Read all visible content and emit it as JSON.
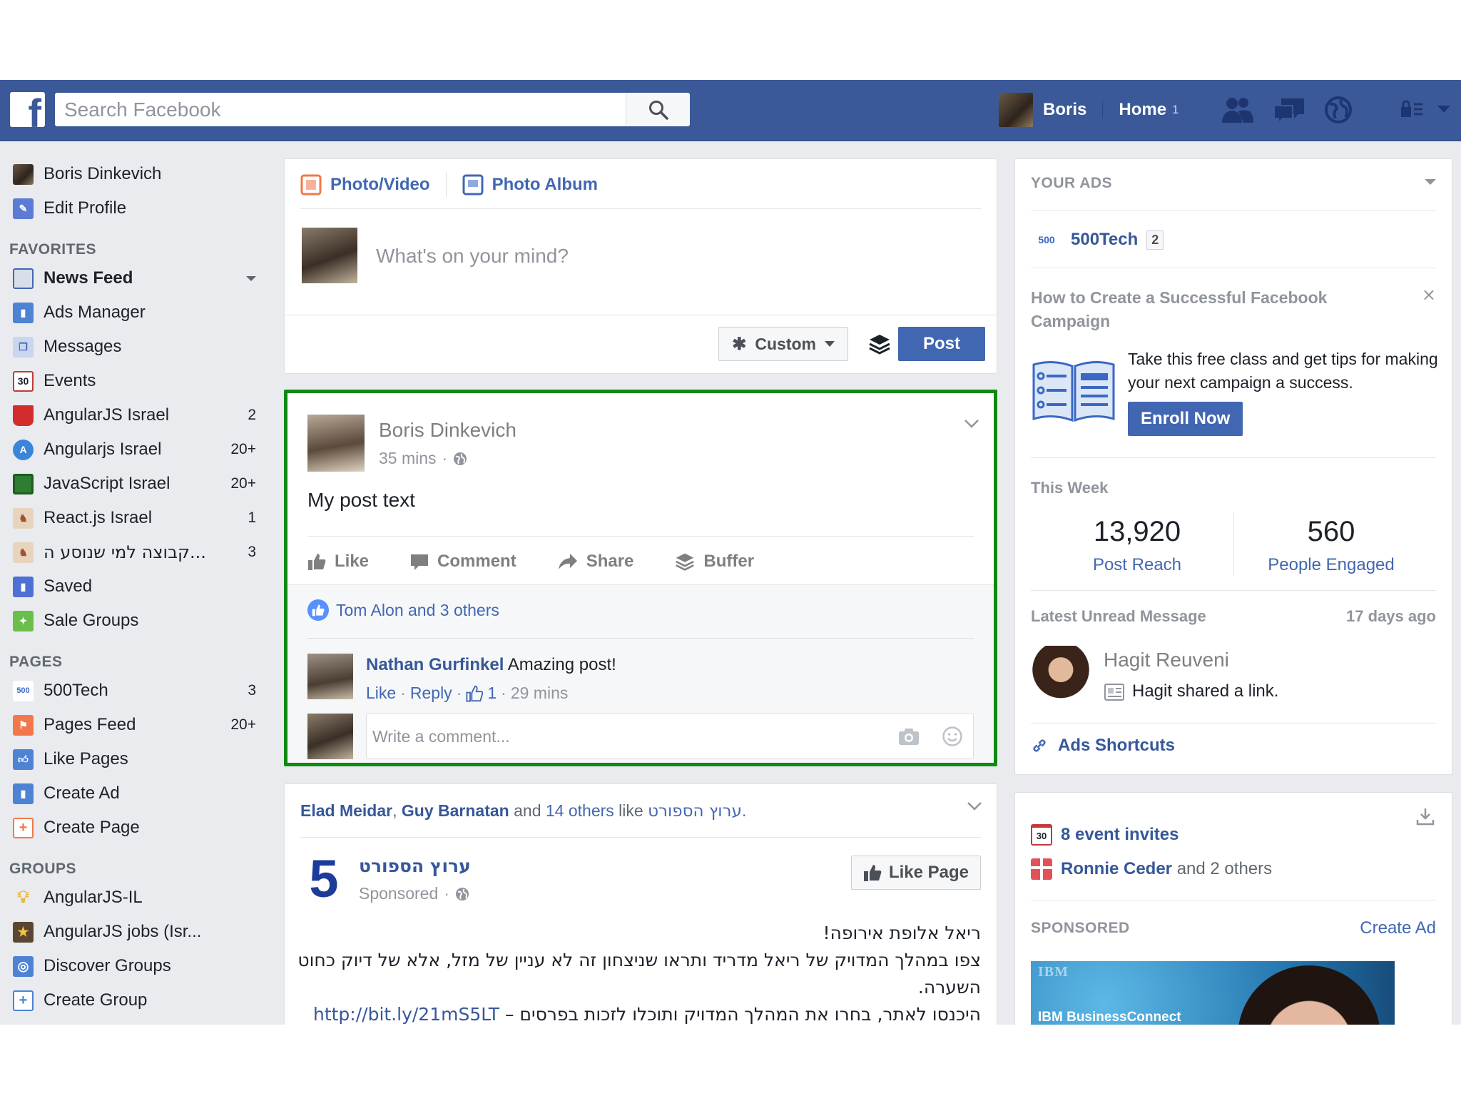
{
  "header": {
    "search_placeholder": "Search Facebook",
    "user_name": "Boris",
    "home_label": "Home",
    "home_count": "1"
  },
  "left_nav": {
    "profile": [
      {
        "label": "Boris Dinkevich"
      },
      {
        "label": "Edit Profile"
      }
    ],
    "favorites_heading": "FAVORITES",
    "favorites": [
      {
        "label": "News Feed",
        "count": ""
      },
      {
        "label": "Ads Manager",
        "count": ""
      },
      {
        "label": "Messages",
        "count": ""
      },
      {
        "label": "Events",
        "count": ""
      },
      {
        "label": "AngularJS Israel",
        "count": "2"
      },
      {
        "label": "Angularjs Israel",
        "count": "20+"
      },
      {
        "label": "JavaScript Israel",
        "count": "20+"
      },
      {
        "label": "React.js Israel",
        "count": "1"
      },
      {
        "label": "קבוצה למי שנוסע ה...",
        "count": "3"
      },
      {
        "label": "Saved",
        "count": ""
      },
      {
        "label": "Sale Groups",
        "count": ""
      }
    ],
    "pages_heading": "PAGES",
    "pages": [
      {
        "label": "500Tech",
        "count": "3"
      },
      {
        "label": "Pages Feed",
        "count": "20+"
      },
      {
        "label": "Like Pages",
        "count": ""
      },
      {
        "label": "Create Ad",
        "count": ""
      },
      {
        "label": "Create Page",
        "count": ""
      }
    ],
    "groups_heading": "GROUPS",
    "groups": [
      {
        "label": "AngularJS-IL"
      },
      {
        "label": "AngularJS jobs (Isr..."
      },
      {
        "label": "Discover Groups"
      },
      {
        "label": "Create Group"
      }
    ]
  },
  "composer": {
    "tab_photo_video": "Photo/Video",
    "tab_photo_album": "Photo Album",
    "placeholder": "What's on your mind?",
    "privacy_label": "Custom",
    "post_label": "Post"
  },
  "post": {
    "author": "Boris Dinkevich",
    "time": "35 mins",
    "dot": "·",
    "text": "My post text",
    "actions": {
      "like": "Like",
      "comment": "Comment",
      "share": "Share",
      "buffer": "Buffer"
    },
    "likes_summary": "Tom Alon and 3 others",
    "comment": {
      "author": "Nathan Gurfinkel",
      "text": "Amazing post!",
      "like": "Like",
      "reply": "Reply",
      "like_count": "1",
      "time": "29 mins"
    },
    "write_placeholder": "Write a comment..."
  },
  "sponsored_post": {
    "friend1": "Elad Meidar",
    "friend2": "Guy Barnatan",
    "and_text": " and ",
    "others": "14 others",
    "like_text": " like ",
    "page_ref": "ערוץ הספורט",
    "page_name": "ערוץ הספורט",
    "sponsored": "Sponsored",
    "like_page": "Like Page",
    "line1": "ריאל אלופת אירופה!",
    "line2": "צפו במהלך המדויק של ריאל מדריד ותראו שניצחון זה לא עניין של מזל, אלא של דיוק כחוט השערה.",
    "line3": "היכנסו לאתר, בחרו את המהלך המדויק ותוכלו לזכות בפרסים – ",
    "link": "http://bit.ly/21mS5LT"
  },
  "right": {
    "your_ads": "YOUR ADS",
    "page_name": "500Tech",
    "page_badge": "2",
    "campaign_title": "How to Create a Successful Facebook Campaign",
    "close": "×",
    "tip": "Take this free class and get tips for making your next campaign a success.",
    "enroll": "Enroll Now",
    "this_week": "This Week",
    "reach_num": "13,920",
    "reach_lbl": "Post Reach",
    "engaged_num": "560",
    "engaged_lbl": "People Engaged",
    "unread_title": "Latest Unread Message",
    "unread_ago": "17 days ago",
    "msg_name": "Hagit Reuveni",
    "msg_text": "Hagit shared a link.",
    "shortcuts": "Ads Shortcuts"
  },
  "events": {
    "invites": "8 event invites",
    "cal_day": "30",
    "birthday_name": "Ronnie Ceder",
    "birthday_rest": " and 2 others",
    "sponsored_label": "SPONSORED",
    "create_ad": "Create Ad",
    "ad_logo": "IBM",
    "ad_text": "IBM BusinessConnect"
  },
  "colors": {
    "brand": "#3b5998",
    "link": "#4267b2",
    "highlight": "#0f8a10"
  }
}
